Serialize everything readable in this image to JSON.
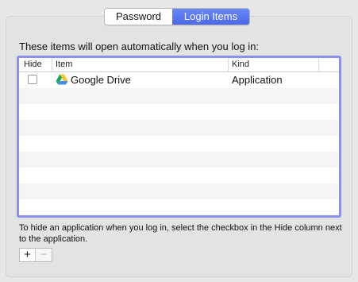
{
  "tabs": [
    {
      "label": "Password",
      "selected": false
    },
    {
      "label": "Login Items",
      "selected": true
    }
  ],
  "intro_text": "These items will open automatically when you log in:",
  "table": {
    "columns": {
      "hide": "Hide",
      "item": "Item",
      "kind": "Kind"
    },
    "rows": [
      {
        "hide": false,
        "icon": "google-drive-icon",
        "item": "Google Drive",
        "kind": "Application"
      }
    ],
    "focus_ring_color": "#8a8ff0"
  },
  "help_text": "To hide an application when you log in, select the checkbox in the Hide column next to the application.",
  "buttons": {
    "add_label": "+",
    "remove_label": "−"
  },
  "colors": {
    "accent": "#4a68ea",
    "background": "#e7e7e7"
  }
}
